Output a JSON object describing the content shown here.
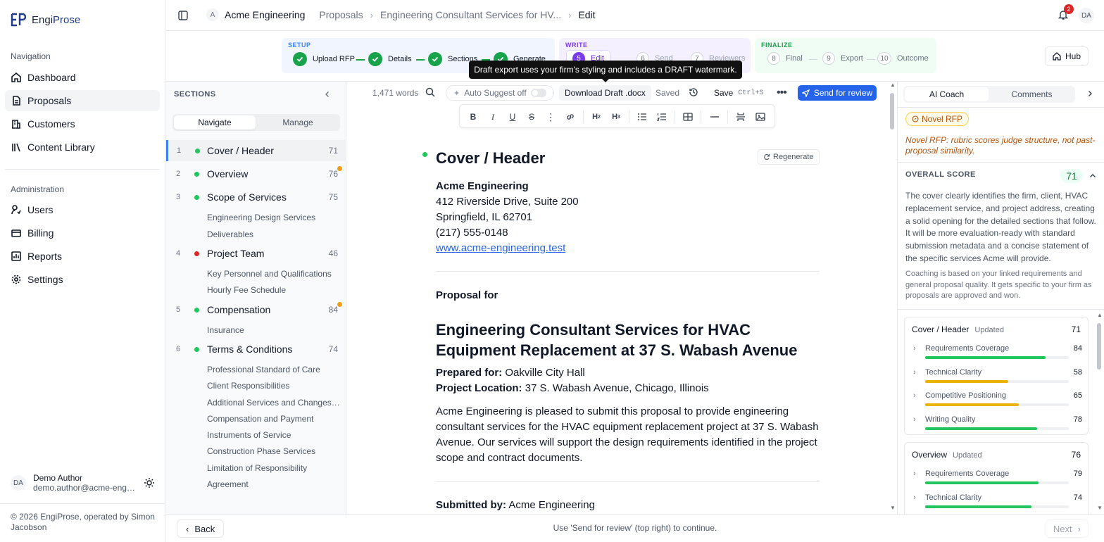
{
  "app": {
    "brand_a": "Engi",
    "brand_b": "Prose"
  },
  "sidebar": {
    "nav_heading": "Navigation",
    "nav": [
      {
        "label": "Dashboard",
        "icon": "dashboard-icon"
      },
      {
        "label": "Proposals",
        "icon": "document-icon",
        "active": true
      },
      {
        "label": "Customers",
        "icon": "building-icon"
      },
      {
        "label": "Content Library",
        "icon": "library-icon"
      }
    ],
    "admin_heading": "Administration",
    "admin": [
      {
        "label": "Users",
        "icon": "users-icon"
      },
      {
        "label": "Billing",
        "icon": "billing-icon"
      },
      {
        "label": "Reports",
        "icon": "reports-icon"
      },
      {
        "label": "Settings",
        "icon": "gear-icon"
      }
    ],
    "user": {
      "initials": "DA",
      "name": "Demo Author",
      "email": "demo.author@acme-engineering.test"
    },
    "copyright": "© 2026 EngiProse, operated by Simon Jacobson"
  },
  "topbar": {
    "org_initial": "A",
    "org": "Acme Engineering",
    "crumbs": [
      "Proposals",
      "Engineering Consultant Services for HV...",
      "Edit"
    ],
    "notifications": "2",
    "user_initials": "DA"
  },
  "stepper": {
    "setup_label": "SETUP",
    "write_label": "WRITE",
    "finalize_label": "FINALIZE",
    "steps": [
      {
        "n": "1",
        "label": "Upload RFP"
      },
      {
        "n": "2",
        "label": "Details"
      },
      {
        "n": "3",
        "label": "Sections"
      },
      {
        "n": "4",
        "label": "Generate"
      },
      {
        "n": "5",
        "label": "Edit"
      },
      {
        "n": "6",
        "label": "Send"
      },
      {
        "n": "7",
        "label": "Reviewers"
      },
      {
        "n": "8",
        "label": "Final"
      },
      {
        "n": "9",
        "label": "Export"
      },
      {
        "n": "10",
        "label": "Outcome"
      }
    ],
    "hub": "Hub"
  },
  "tooltip": "Draft export uses your firm's styling and includes a DRAFT watermark.",
  "sections_panel": {
    "title": "SECTIONS",
    "tab_navigate": "Navigate",
    "tab_manage": "Manage",
    "items": [
      {
        "n": "1",
        "label": "Cover / Header",
        "score": "71",
        "status": "green"
      },
      {
        "n": "2",
        "label": "Overview",
        "score": "76",
        "status": "green"
      },
      {
        "n": "3",
        "label": "Scope of Services",
        "score": "75",
        "status": "green"
      },
      {
        "n": "4",
        "label": "Project Team",
        "score": "46",
        "status": "red"
      },
      {
        "n": "5",
        "label": "Compensation",
        "score": "84",
        "status": "green"
      },
      {
        "n": "6",
        "label": "Terms & Conditions",
        "score": "74",
        "status": "green"
      }
    ],
    "subs": {
      "s3": [
        "Engineering Design Services",
        "Deliverables"
      ],
      "s4": [
        "Key Personnel and Qualifications",
        "Hourly Fee Schedule"
      ],
      "s5": [
        "Insurance"
      ],
      "s6": [
        "Professional Standard of Care",
        "Client Responsibilities",
        "Additional Services and Changes in Scope",
        "Compensation and Payment",
        "Instruments of Service",
        "Construction Phase Services",
        "Limitation of Responsibility",
        "Agreement"
      ]
    }
  },
  "editor": {
    "word_count": "1,471 words",
    "auto_suggest": "Auto Suggest off",
    "download": "Download Draft .docx",
    "saved": "Saved",
    "save": "Save",
    "shortcut": "Ctrl+S",
    "send": "Send for review",
    "regenerate": "Regenerate",
    "doc": {
      "heading": "Cover / Header",
      "firm": "Acme Engineering",
      "addr1": "412 Riverside Drive, Suite 200",
      "addr2": "Springfield, IL 62701",
      "phone": "(217) 555-0148",
      "web": "www.acme-engineering.test",
      "proposal_for": "Proposal for",
      "title": "Engineering Consultant Services for HVAC Equipment Replacement at 37 S. Wabash Avenue",
      "prepared_label": "Prepared for:",
      "prepared_value": "Oakville City Hall",
      "location_label": "Project Location:",
      "location_value": "37 S. Wabash Avenue, Chicago, Illinois",
      "intro": "Acme Engineering is pleased to submit this proposal to provide engineering consultant services for the HVAC equipment replacement project at 37 S. Wabash Avenue. Our services will support the design requirements identified in the project scope and contract documents.",
      "submitted_label": "Submitted by:",
      "submitted_value": "Acme Engineering"
    }
  },
  "coach": {
    "tab_coach": "AI Coach",
    "tab_comments": "Comments",
    "novel": "Novel RFP",
    "novel_note": "Novel RFP: rubric scores judge structure, not past-proposal similarity.",
    "overall_label": "OVERALL SCORE",
    "overall_score": "71",
    "summary": "The cover clearly identifies the firm, client, HVAC replacement service, and project address, creating a solid opening for the detailed sections that follow. It will be more evaluation-ready with standard submission metadata and a concise statement of the specific services Acme will provide.",
    "note": "Coaching is based on your linked requirements and general proposal quality. It gets specific to your firm as proposals are approved and won.",
    "cards": [
      {
        "title": "Cover / Header",
        "updated": "Updated",
        "score": "71",
        "metrics": [
          {
            "name": "Requirements Coverage",
            "value": 84,
            "color": "#22c55e"
          },
          {
            "name": "Technical Clarity",
            "value": 58,
            "color": "#eab308"
          },
          {
            "name": "Competitive Positioning",
            "value": 65,
            "color": "#eab308"
          },
          {
            "name": "Writing Quality",
            "value": 78,
            "color": "#22c55e"
          }
        ]
      },
      {
        "title": "Overview",
        "updated": "Updated",
        "score": "76",
        "metrics": [
          {
            "name": "Requirements Coverage",
            "value": 79,
            "color": "#22c55e"
          },
          {
            "name": "Technical Clarity",
            "value": 74,
            "color": "#22c55e"
          }
        ]
      }
    ]
  },
  "bottom": {
    "back": "Back",
    "hint": "Use 'Send for review' (top right) to continue.",
    "next": "Next"
  }
}
